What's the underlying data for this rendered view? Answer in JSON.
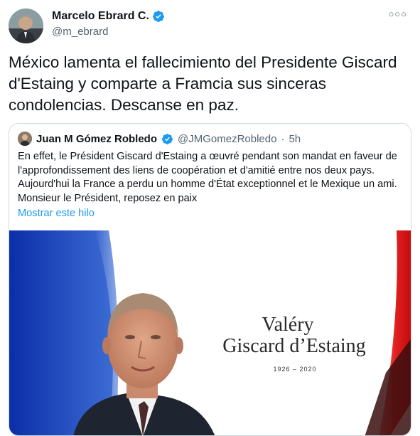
{
  "author": {
    "name": "Marcelo Ebrard C.",
    "handle": "@m_ebrard",
    "verified": true
  },
  "more_icon": "more-dots-icon",
  "tweet_text": "México lamenta el fallecimiento del Presidente Giscard d'Estaing y comparte a Framcia sus sinceras condolencias. Descanse en paz.",
  "quoted": {
    "name": "Juan M Gómez Robledo",
    "handle": "@JMGomezRobledo",
    "separator": "·",
    "time": "5h",
    "text": "En effet, le Président Giscard d'Estaing a œuvré pendant son mandat en faveur de l'approfondissement des liens de coopération et d'amitié entre nos deux pays. Aujourd'hui la France a perdu un homme d'État exceptionnel et le Mexique un ami. Monsieur le Président, reposez en paix",
    "show_thread": "Mostrar este hilo",
    "image": {
      "first_name": "Valéry",
      "last_name": "Giscard d’Estaing",
      "years": "1926 – 2020"
    }
  },
  "colors": {
    "accent": "#1d9bf0",
    "flag_blue": "#002395",
    "flag_red": "#ED2939"
  }
}
